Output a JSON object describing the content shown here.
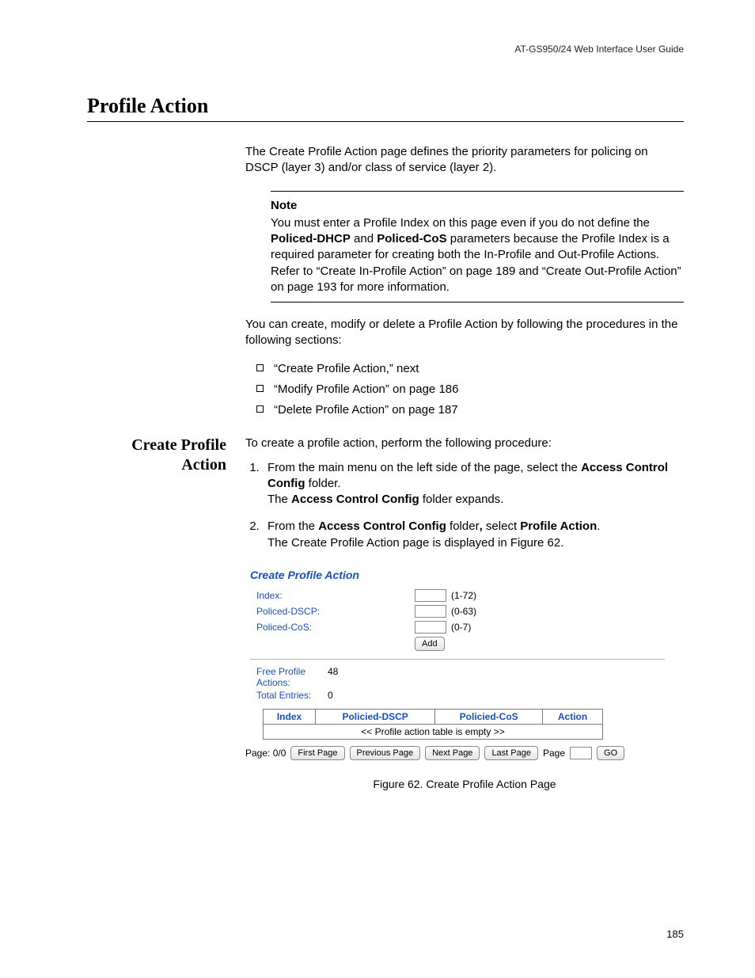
{
  "header": {
    "guide": "AT-GS950/24  Web Interface User Guide"
  },
  "title": "Profile Action",
  "intro": "The Create Profile Action page defines the priority parameters for policing on DSCP (layer 3) and/or class of service (layer 2).",
  "note": {
    "head": "Note",
    "body_a": "You must enter a Profile Index on this page even if you do not define the ",
    "b1": "Policed-DHCP",
    "mid": " and ",
    "b2": "Policed-CoS",
    "body_b": " parameters because the Profile Index is a required parameter for creating both the In-Profile and Out-Profile Actions. Refer to “Create In-Profile Action” on page 189 and “Create Out-Profile Action” on page 193 for more information."
  },
  "lead2": "You can create, modify or delete a Profile Action by following the procedures in the following sections:",
  "bullets": [
    "“Create Profile Action,”  next",
    "“Modify Profile Action” on page 186",
    "“Delete Profile Action” on page 187"
  ],
  "sidehead": "Create Profile Action",
  "proc_intro": "To create a profile action, perform the following procedure:",
  "step1": {
    "a": "From the main menu on the left side of the page, select the ",
    "b": "Access Control Config",
    "c": " folder.",
    "d_a": "The ",
    "d_b": "Access Control Config",
    "d_c": " folder expands."
  },
  "step2": {
    "a": "From the ",
    "b": "Access Control Config",
    "c": " folder",
    "comma": ", ",
    "d": "select ",
    "e": "Profile Action",
    "f": ".",
    "g": "The Create Profile Action page is displayed in Figure 62."
  },
  "fig": {
    "title": "Create Profile Action",
    "labels": {
      "index": "Index:",
      "dscp": "Policed-DSCP:",
      "cos": "Policed-CoS:"
    },
    "ranges": {
      "index": "(1-72)",
      "dscp": "(0-63)",
      "cos": "(0-7)"
    },
    "add": "Add",
    "free_label": "Free Profile Actions:",
    "free_val": "48",
    "total_label": "Total Entries:",
    "total_val": "0",
    "cols": {
      "c1": "Index",
      "c2": "Policied-DSCP",
      "c3": "Policied-CoS",
      "c4": "Action"
    },
    "empty": "<< Profile action table is empty >>",
    "pager": {
      "page": "Page: 0/0",
      "first": "First Page",
      "prev": "Previous Page",
      "next": "Next Page",
      "last": "Last Page",
      "pglabel": "Page",
      "go": "GO"
    }
  },
  "caption": "Figure 62. Create Profile Action Page",
  "pagenum": "185",
  "chart_data": {
    "type": "table",
    "title": "Create Profile Action",
    "fields": [
      {
        "name": "Index",
        "range": "1-72",
        "value": ""
      },
      {
        "name": "Policed-DSCP",
        "range": "0-63",
        "value": ""
      },
      {
        "name": "Policed-CoS",
        "range": "0-7",
        "value": ""
      }
    ],
    "free_profile_actions": 48,
    "total_entries": 0,
    "columns": [
      "Index",
      "Policied-DSCP",
      "Policied-CoS",
      "Action"
    ],
    "rows": [],
    "page": "0/0"
  }
}
